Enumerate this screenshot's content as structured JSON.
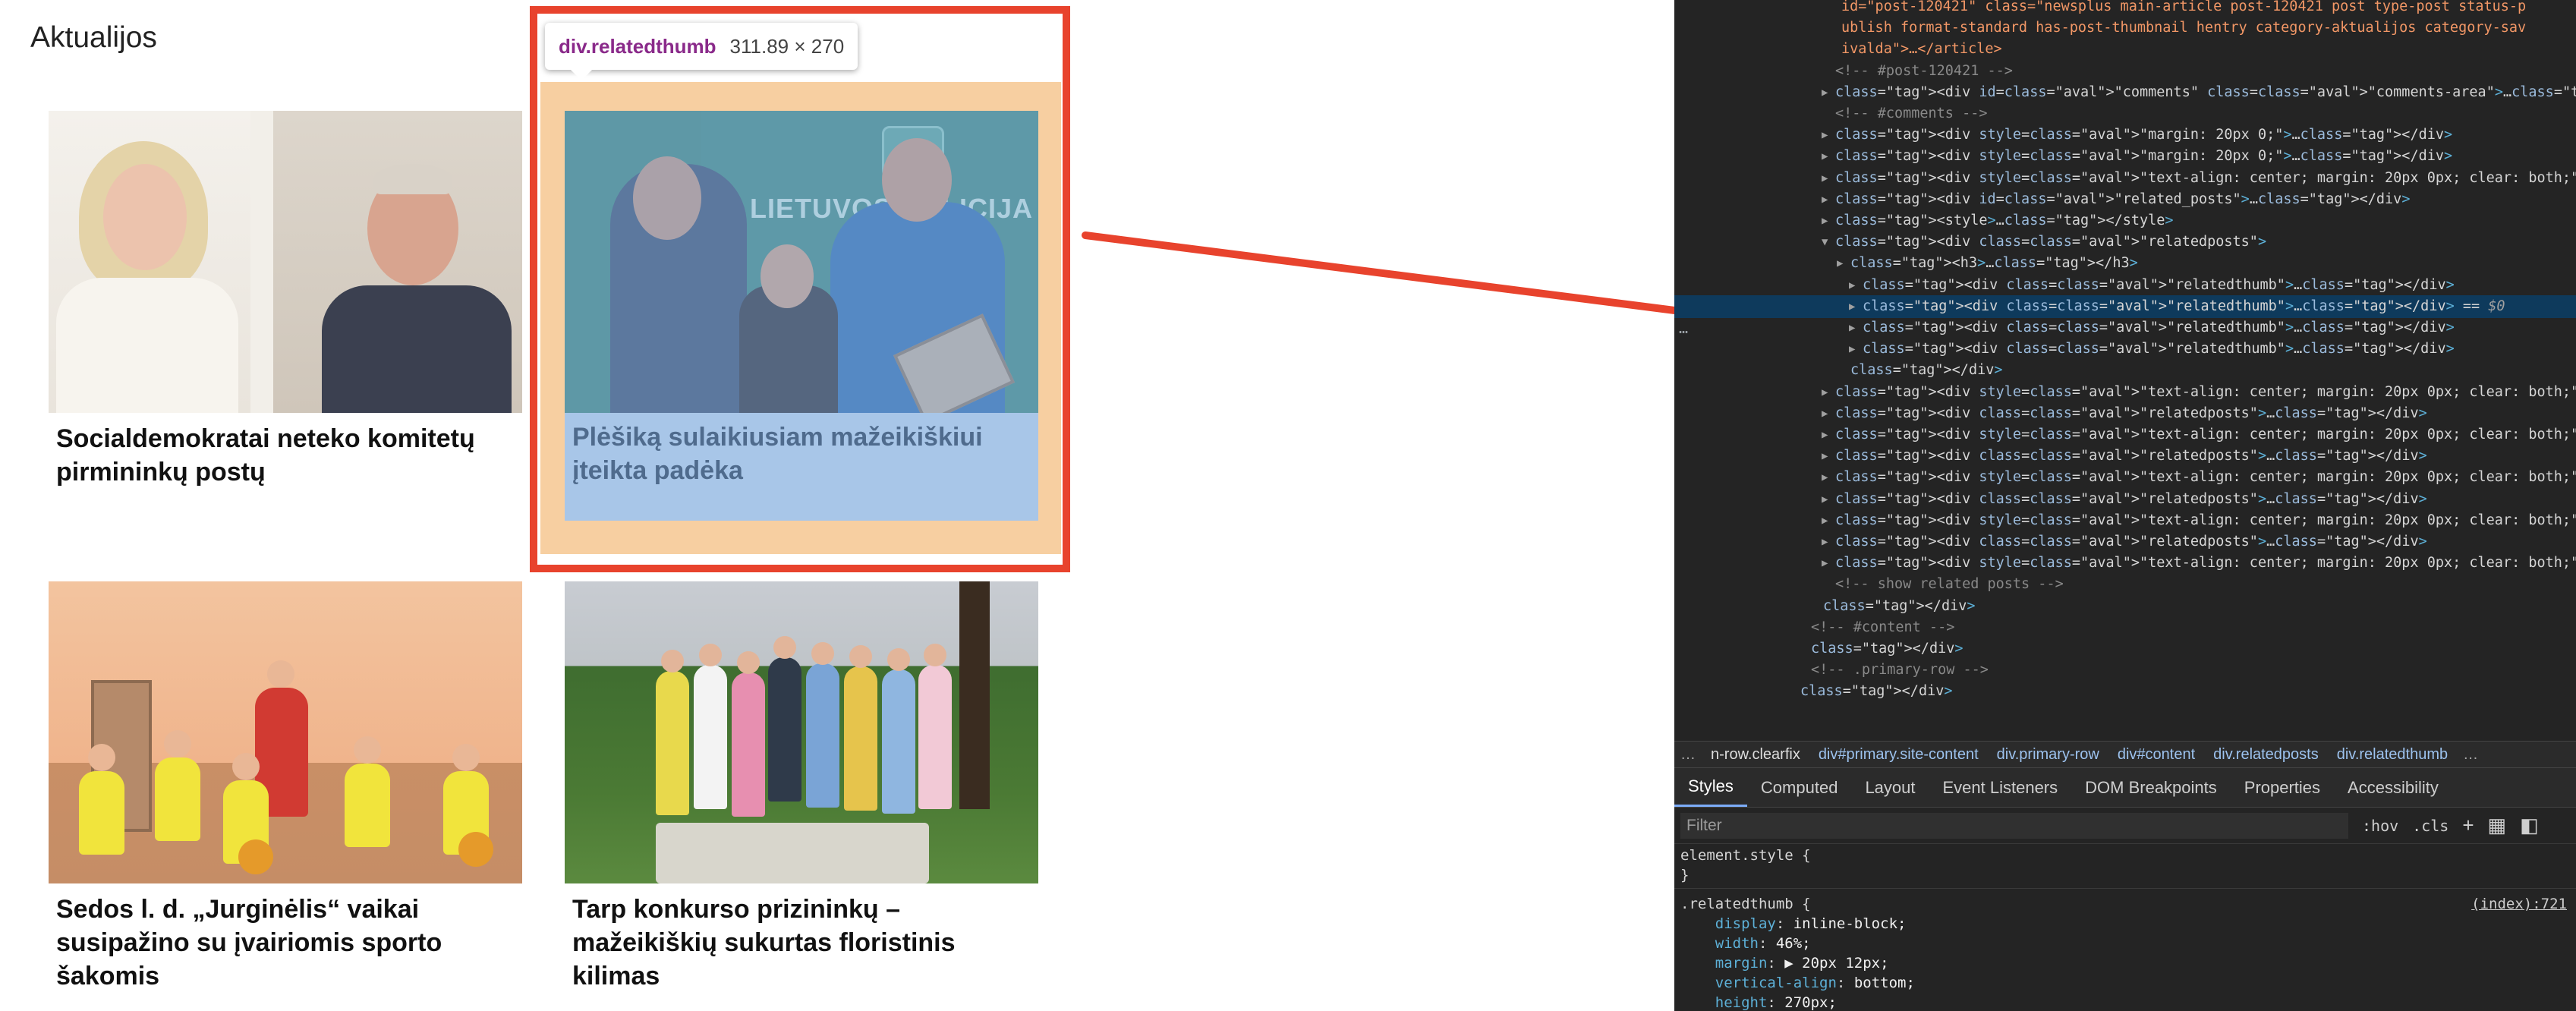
{
  "section": {
    "title": "Aktualijos"
  },
  "tooltip": {
    "selector": "div.relatedthumb",
    "size": "311.89 × 270"
  },
  "posts": [
    {
      "caption": "Socialdemokratai neteko komitetų pirmininkų postų"
    },
    {
      "caption": "Plėšiką sulaikiusiam mažeikiškiui įteikta padėka",
      "image_text": "LIETUVOS POLICIJA"
    },
    {
      "caption": "Sedos l. d. „Jurginėlis“ vaikai susipažino su įvairiomis sporto šakomis"
    },
    {
      "caption": "Tarp konkurso prizininkų – mažeikiškių sukurtas floristinis kilimas"
    }
  ],
  "devtools": {
    "dom_lines": [
      {
        "text": "id=\"post-120421\" class=\"newsplus main-article post-120421 post type-post status-p",
        "kind": "attr"
      },
      {
        "text": "ublish format-standard has-post-thumbnail hentry category-aktualijos category-sav",
        "kind": "attr"
      },
      {
        "text": "ivalda\">…</article>",
        "kind": "attr"
      },
      {
        "text": "<!-- #post-120421 -->",
        "kind": "comment"
      },
      {
        "text": "<div id=\"comments\" class=\"comments-area\">…</div>",
        "kind": "tag"
      },
      {
        "text": "<!-- #comments -->",
        "kind": "comment"
      },
      {
        "text": "<div style=\"margin: 20px 0;\">…</div>",
        "kind": "tag"
      },
      {
        "text": "<div style=\"margin: 20px 0;\">…</div>",
        "kind": "tag"
      },
      {
        "text": "<div style=\"text-align: center; margin: 20px 0px; clear: both;\">…</div>",
        "kind": "tag"
      },
      {
        "text": "<div id=\"related_posts\">…</div>",
        "kind": "tag"
      },
      {
        "text": "<style>…</style>",
        "kind": "tag"
      },
      {
        "text": "<div class=\"relatedposts\">",
        "kind": "tag"
      },
      {
        "text": "<h3>…</h3>",
        "kind": "tag"
      },
      {
        "text": "<div class=\"relatedthumb\">…</div>",
        "kind": "tag"
      },
      {
        "text": "<div class=\"relatedthumb\">…</div> == $0",
        "kind": "tag"
      },
      {
        "text": "<div class=\"relatedthumb\">…</div>",
        "kind": "tag"
      },
      {
        "text": "<div class=\"relatedthumb\">…</div>",
        "kind": "tag"
      },
      {
        "text": "</div>",
        "kind": "tag"
      },
      {
        "text": "<div style=\"text-align: center; margin: 20px 0px; clear: both;\">…</div>",
        "kind": "tag"
      },
      {
        "text": "<div class=\"relatedposts\">…</div>",
        "kind": "tag"
      },
      {
        "text": "<div style=\"text-align: center; margin: 20px 0px; clear: both;\">…</div>",
        "kind": "tag"
      },
      {
        "text": "<div class=\"relatedposts\">…</div>",
        "kind": "tag"
      },
      {
        "text": "<div style=\"text-align: center; margin: 20px 0px; clear: both;\">…</div>",
        "kind": "tag"
      },
      {
        "text": "<div class=\"relatedposts\">…</div>",
        "kind": "tag"
      },
      {
        "text": "<div style=\"text-align: center; margin: 20px 0px; clear: both;\">…</div>",
        "kind": "tag"
      },
      {
        "text": "<div class=\"relatedposts\">…</div>",
        "kind": "tag"
      },
      {
        "text": "<div style=\"text-align: center; margin: 20px 0px; clear: both;\">…</div>",
        "kind": "tag"
      },
      {
        "text": "<!-- show related posts -->",
        "kind": "comment"
      },
      {
        "text": "</div>",
        "kind": "tag"
      },
      {
        "text": "<!-- #content -->",
        "kind": "comment"
      },
      {
        "text": "</div>",
        "kind": "tag"
      },
      {
        "text": "<!-- .primary-row -->",
        "kind": "comment"
      },
      {
        "text": "</div>",
        "kind": "tag"
      }
    ],
    "breadcrumbs": [
      "n-row.clearfix",
      "div#primary.site-content",
      "div.primary-row",
      "div#content",
      "div.relatedposts",
      "div.relatedthumb"
    ],
    "tabs": [
      "Styles",
      "Computed",
      "Layout",
      "Event Listeners",
      "DOM Breakpoints",
      "Properties",
      "Accessibility"
    ],
    "active_tab": "Styles",
    "filter_placeholder": "Filter",
    "hov_label": ":hov",
    "cls_label": ".cls",
    "styles": {
      "element_style": "element.style {",
      "element_close": "}",
      "rule_selector": ".relatedthumb {",
      "rule_source": "(index):721",
      "props": [
        {
          "name": "display",
          "value": "inline-block;"
        },
        {
          "name": "width",
          "value": "46%;"
        },
        {
          "name": "margin",
          "value": "▶ 20px 12px;"
        },
        {
          "name": "vertical-align",
          "value": "bottom;"
        },
        {
          "name": "height",
          "value": "270px;"
        }
      ]
    }
  }
}
